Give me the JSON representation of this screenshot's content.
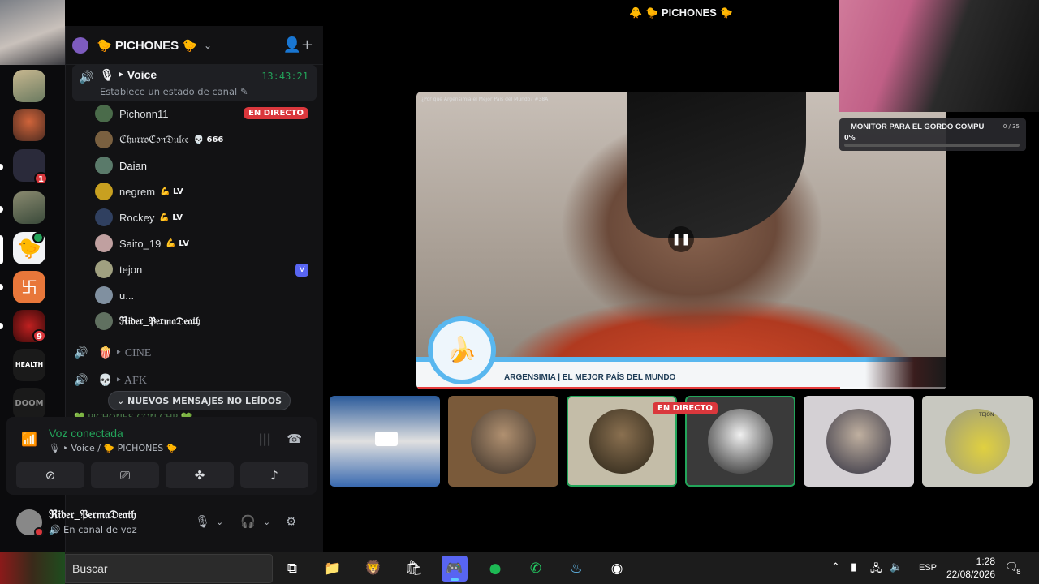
{
  "server": {
    "name": "🐤 PICHONES 🐤",
    "stage_title": "🐥  🐤 PICHONES 🐤"
  },
  "active_voice": {
    "name": "🎙 ‣ Voice",
    "time": "13:43:21",
    "status_placeholder": "Establece un estado de canal"
  },
  "members": [
    {
      "name": "Pichonn11",
      "badge": "EN DIRECTO",
      "avatar_color": "#4a6b4a"
    },
    {
      "name": "ℭ𝔥𝔲𝔯𝔯𝔬ℭ𝔬𝔫𝔇𝔲𝔩𝔠𝔢",
      "tag": "💀 666",
      "avatar_color": "#7a6040"
    },
    {
      "name": "Daian",
      "avatar_color": "#5a7a6a"
    },
    {
      "name": "negrem",
      "tag": "💪 LV",
      "avatar_color": "#c8a020"
    },
    {
      "name": "Rockey",
      "tag": "💪 LV",
      "avatar_color": "#304060"
    },
    {
      "name": "Saito_19",
      "tag": "💪 LV",
      "avatar_color": "#c0a0a0"
    },
    {
      "name": "tejon",
      "badge_v": "V",
      "avatar_color": "#a0a080"
    },
    {
      "name": "u...",
      "avatar_color": "#8090a0"
    },
    {
      "name": "ℜ𝔦𝔡𝔢𝔯_𝔓𝔢𝔯𝔪𝔞𝔇𝔢𝔞𝔱𝔥",
      "avatar_color": "#607060"
    }
  ],
  "channels": [
    {
      "icon": "🔊",
      "name": "🍿 ‣ CINE"
    },
    {
      "icon": "🔊",
      "name": "💀 ‣ AFK"
    }
  ],
  "new_messages": "⌄  NUEVOS MENSAJES NO LEÍDOS",
  "hidden_channel": "💚 PICHONES CON CHP 💚",
  "voice_panel": {
    "title": "Voz conectada",
    "subtitle": "🎙 ‣ Voice / 🐤 PICHONES 🐤"
  },
  "user": {
    "name": "ℜ𝔦𝔡𝔢𝔯_𝔓𝔢𝔯𝔪𝔞𝔇𝔢𝔞𝔱𝔥",
    "status": "🔊 En canal de voz"
  },
  "rail_badges": [
    "1",
    "9"
  ],
  "rail_labels": [
    "HEALTH",
    "DOOM"
  ],
  "video": {
    "title": "¿Por qué Argensimia el Mejor País del Mundo? #38A",
    "lower_third": "ARGENSIMIA | EL MEJOR PAÍS DEL MUNDO",
    "progress": 0.8
  },
  "monitor_widget": {
    "title": "MONITOR PARA EL GORDO COMPU",
    "count": "0 / 35",
    "percent_label": "0%",
    "progress": 0.0
  },
  "tiles": {
    "live_label": "EN DIRECTO",
    "tejon_label": "TEJON"
  },
  "taskbar": {
    "search_placeholder": "Buscar",
    "time": "1:28",
    "date": "22/08/2026",
    "language": "ESP",
    "notifications": "8"
  },
  "colors": {
    "accent_green": "#23a55a",
    "live_red": "#da373c",
    "lower_third_blue": "#59b7ef"
  }
}
